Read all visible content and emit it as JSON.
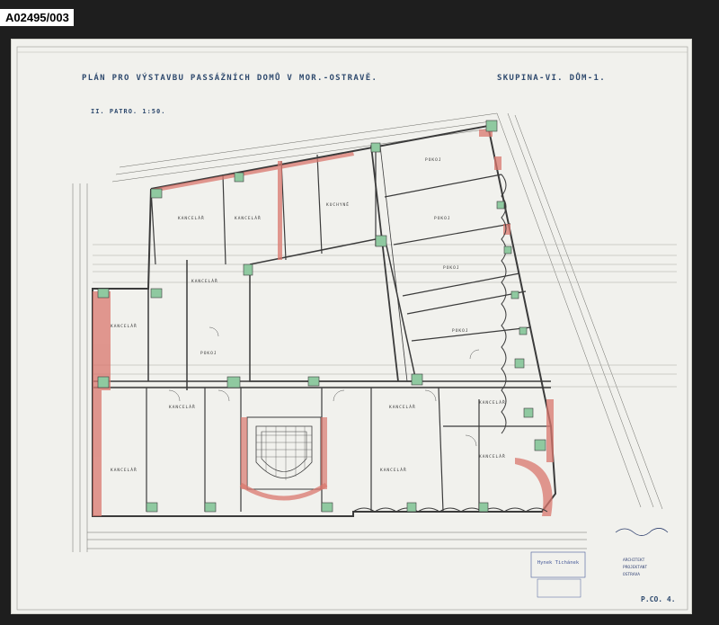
{
  "catalog": {
    "id": "A02495/003"
  },
  "sheet": {
    "title": "PLÁN PRO VÝSTAVBU PASSÁŽNÍCH DOMŮ V MOR.-OSTRAVĚ.",
    "group": "SKUPINA-VI. DŮM-1.",
    "floor": "II. PATRO. 1:50.",
    "sheet_number": "P.CO. 4.",
    "stamp_lines": [
      "ARCHITEKT",
      "PROJEKTANT",
      "OSTRAVA"
    ],
    "signature": "Hynek Tichánek"
  },
  "rooms": [
    "KANCELÁŘ",
    "KANCELÁŘ",
    "KANCELÁŘ",
    "KANCELÁŘ",
    "POKOJ",
    "POKOJ",
    "POKOJ",
    "KUCHYNĚ",
    "POKOJ",
    "KANCELÁŘ",
    "KANCELÁŘ",
    "KANCELÁŘ",
    "KANCELÁŘ",
    "KANCELÁŘ",
    "KANCELÁŘ",
    "POKOJ"
  ],
  "colors": {
    "wall_red": "#d9776e",
    "column_green": "#8fc9a0",
    "line_ink": "#3b3b3b",
    "paper": "#f1f1ed"
  }
}
